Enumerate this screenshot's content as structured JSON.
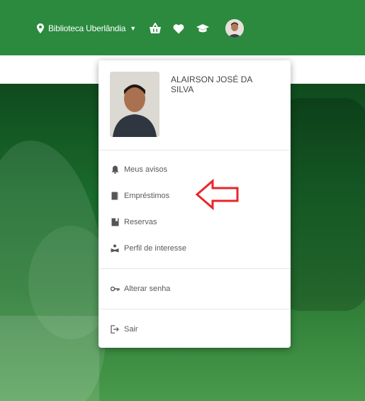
{
  "header": {
    "location_label": "Biblioteca Uberlândia",
    "icons": [
      "map-pin-icon",
      "basket-icon",
      "heart-icon",
      "graduation-cap-icon"
    ]
  },
  "user_menu": {
    "user_name": "ALAIRSON JOSÉ DA SILVA",
    "items": [
      {
        "label": "Meus avisos",
        "icon": "bell-icon"
      },
      {
        "label": "Empréstimos",
        "icon": "book-icon"
      },
      {
        "label": "Reservas",
        "icon": "bookmark-icon"
      },
      {
        "label": "Perfil de interesse",
        "icon": "reading-icon"
      },
      {
        "label": "Alterar senha",
        "icon": "key-icon"
      },
      {
        "label": "Sair",
        "icon": "sign-out-icon"
      }
    ]
  },
  "colors": {
    "header_bg": "#2b8a3e",
    "annotation_arrow": "#e8262a"
  }
}
